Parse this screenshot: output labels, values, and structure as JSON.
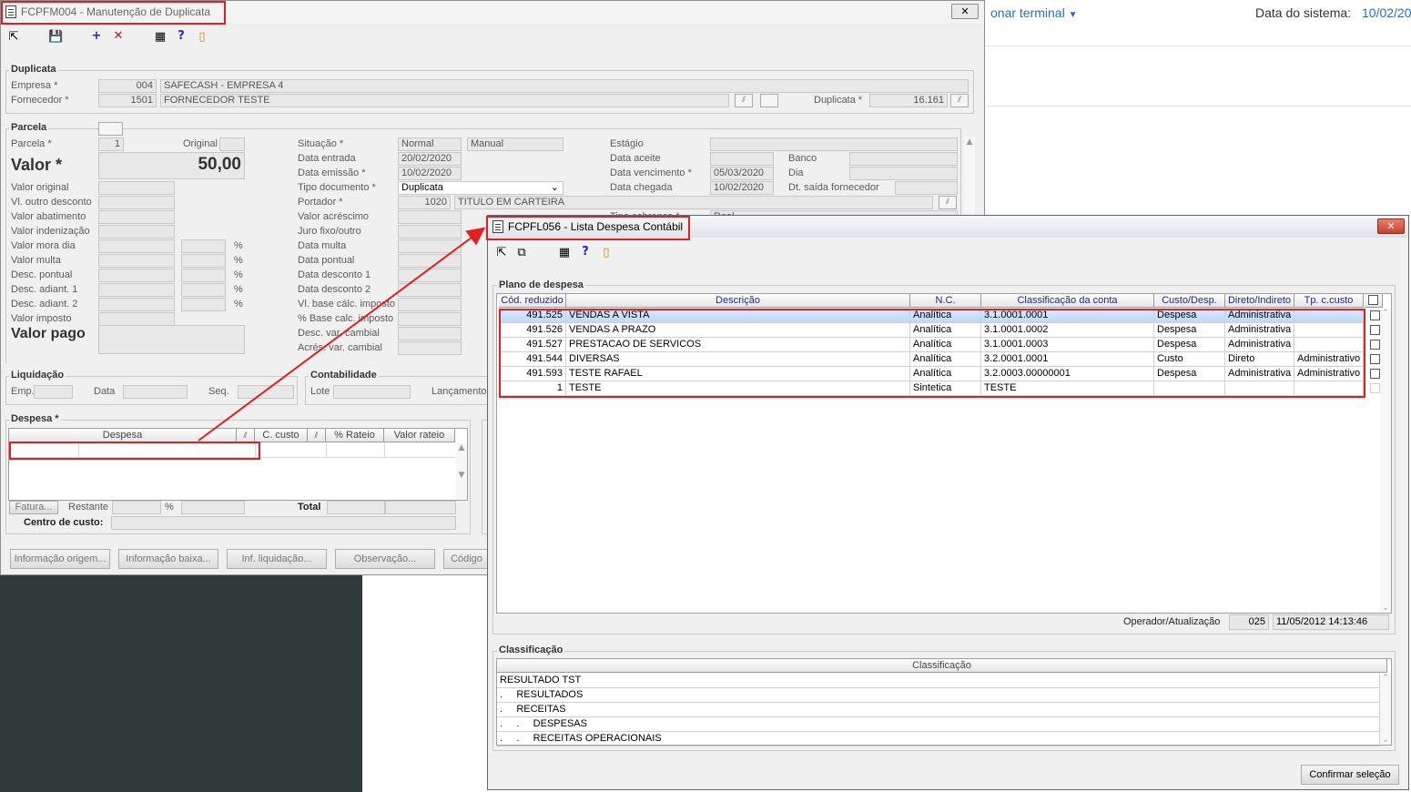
{
  "background": {
    "terminal_link": "onar terminal",
    "system_date_label": "Data do sistema:",
    "system_date_value": "10/02/20"
  },
  "main_window": {
    "title": "FCPFM004 - Manutenção de Duplicata",
    "close_label": "✕",
    "duplicata": {
      "group_title": "Duplicata",
      "empresa_label": "Empresa *",
      "empresa_code": "004",
      "empresa_name": "SAFECASH -  EMPRESA 4",
      "fornecedor_label": "Fornecedor *",
      "fornecedor_code": "1501",
      "fornecedor_name": "FORNECEDOR TESTE",
      "duplicata_label": "Duplicata *",
      "duplicata_value": "16.161"
    },
    "parcela": {
      "group_title": "Parcela",
      "parcela_label": "Parcela *",
      "parcela_value": "1",
      "original_label": "Original",
      "valor_label": "Valor *",
      "valor_value": "50,00",
      "left_labels": [
        "Valor original",
        "Vl. outro desconto",
        "Valor abatimento",
        "Valor indenização",
        "Valor mora dia",
        "Valor multa",
        "Desc. pontual",
        "Desc. adiant. 1",
        "Desc. adiant. 2",
        "Valor imposto"
      ],
      "percent": "%",
      "valor_pago_label": "Valor pago",
      "situacao_label": "Situação *",
      "situacao_value": "Normal",
      "situacao_mode": "Manual",
      "data_entrada_label": "Data entrada",
      "data_entrada_value": "20/02/2020",
      "data_emissao_label": "Data emissão *",
      "data_emissao_value": "10/02/2020",
      "tipo_documento_label": "Tipo documento *",
      "tipo_documento_value": "Duplicata",
      "portador_label": "Portador *",
      "portador_code": "1020",
      "portador_name": "TITULO EM CARTEIRA",
      "mid_labels": [
        "Valor acréscimo",
        "Juro fixo/outro",
        "Data multa",
        "Data pontual",
        "Data desconto 1",
        "Data desconto 2",
        "Vl. base cálc. imposto",
        "% Base calc. imposto",
        "Desc. var. cambial",
        "Acrés. var. cambial"
      ],
      "estagio_label": "Estágio",
      "data_aceite_label": "Data aceite",
      "banco_label": "Banco",
      "data_vencimento_label": "Data vencimento *",
      "data_vencimento_value": "05/03/2020",
      "dia_label": "Dia",
      "data_chegada_label": "Data chegada",
      "data_chegada_value": "10/02/2020",
      "dt_saida_label": "Dt. saída fornecedor",
      "tipo_cobranca_label": "Tipo cobrança *",
      "tipo_cobranca_value": "Real"
    },
    "liquidacao": {
      "group_title": "Liquidação",
      "emp_label": "Emp.",
      "data_label": "Data",
      "seq_label": "Seq."
    },
    "contabilidade": {
      "group_title": "Contabilidade",
      "lote_label": "Lote",
      "lancamento_label": "Lançamento"
    },
    "despesa": {
      "group_title": "Despesa *",
      "columns": [
        "Despesa",
        "C. custo",
        "% Rateio",
        "Valor rateio"
      ],
      "fatura_label": "Fatura...",
      "restante_label": "Restante",
      "percent": "%",
      "total_label": "Total",
      "centro_custo_label": "Centro de custo:"
    },
    "buttons": [
      "Informação origem...",
      "Informação baixa...",
      "Inf. liquidação...",
      "Observação...",
      "Código"
    ]
  },
  "list_window": {
    "title": "FCPFL056 - Lista Despesa Contábil",
    "close_label": "✕",
    "plano_title": "Plano de despesa",
    "columns": [
      "Cód. reduzido",
      "Descrição",
      "N.C.",
      "Classificação da conta",
      "Custo/Desp.",
      "Direto/Indireto",
      "Tp. c.custo"
    ],
    "rows": [
      {
        "codigo": "491.525",
        "descricao": "VENDAS A VISTA",
        "nc": "Analítica",
        "classificacao": "3.1.0001.0001",
        "custo": "Despesa",
        "direto": "Administrativa",
        "tp": ""
      },
      {
        "codigo": "491.526",
        "descricao": "VENDAS A PRAZO",
        "nc": "Analítica",
        "classificacao": "3.1.0001.0002",
        "custo": "Despesa",
        "direto": "Administrativa",
        "tp": ""
      },
      {
        "codigo": "491.527",
        "descricao": "PRESTACAO DE SERVICOS",
        "nc": "Analítica",
        "classificacao": "3.1.0001.0003",
        "custo": "Despesa",
        "direto": "Administrativa",
        "tp": ""
      },
      {
        "codigo": "491.544",
        "descricao": "DIVERSAS",
        "nc": "Analítica",
        "classificacao": "3.2.0001.0001",
        "custo": "Custo",
        "direto": "Direto",
        "tp": "Administrativo"
      },
      {
        "codigo": "491.593",
        "descricao": "TESTE RAFAEL",
        "nc": "Analítica",
        "classificacao": "3.2.0003.00000001",
        "custo": "Despesa",
        "direto": "Administrativa",
        "tp": "Administrativo"
      },
      {
        "codigo": "1",
        "descricao": "TESTE",
        "nc": "Sintetica",
        "classificacao": "TESTE",
        "custo": "",
        "direto": "",
        "tp": ""
      }
    ],
    "operador_label": "Operador/Atualização",
    "operador_value": "025",
    "atualizacao_value": "11/05/2012 14:13:46",
    "classificacao_title": "Classificação",
    "classificacao_column": "Classificação",
    "classificacao_rows": [
      "RESULTADO TST",
      ".     RESULTADOS",
      ".     RECEITAS",
      ".     .     DESPESAS",
      ".     .     RECEITAS OPERACIONAIS"
    ],
    "confirm_label": "Confirmar seleção"
  },
  "colors": {
    "highlight_red": "#e02020",
    "header_text": "#1a2a8a",
    "selected_row": "#c9e0fb"
  }
}
